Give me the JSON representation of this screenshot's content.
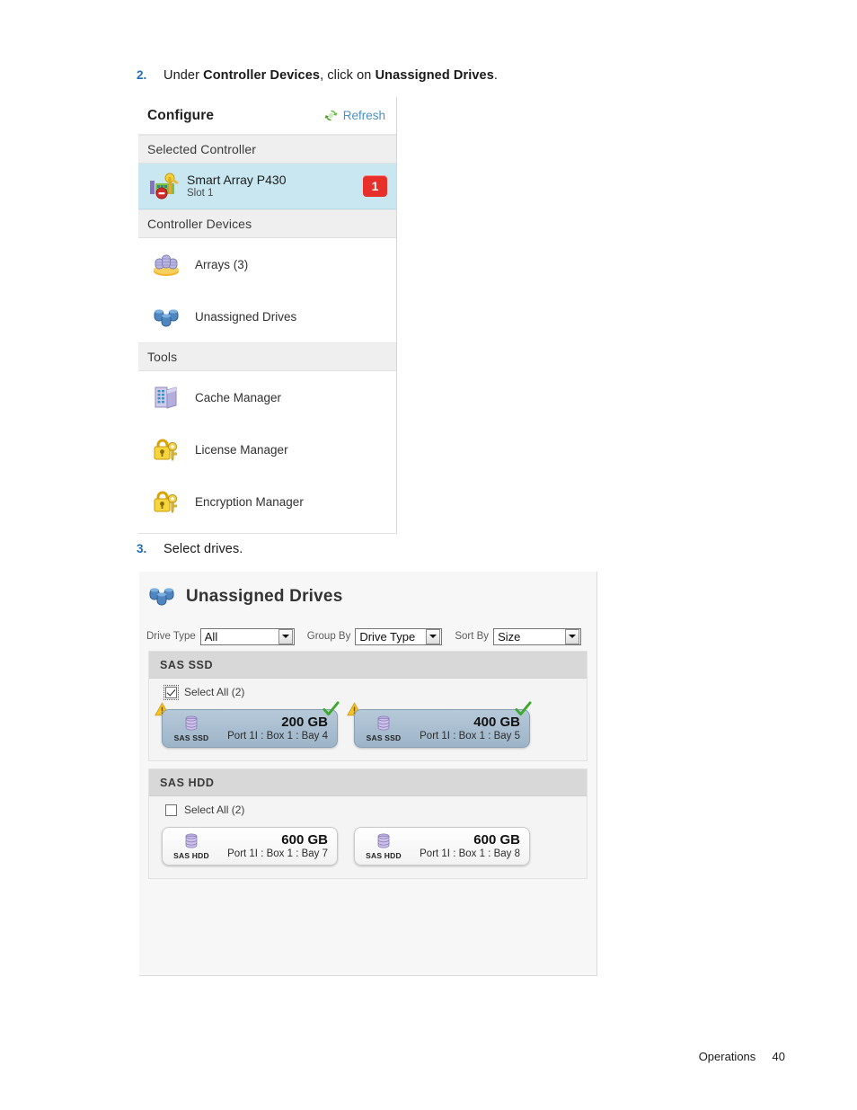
{
  "steps": [
    {
      "number": "2.",
      "pre": "Under ",
      "bold1": "Controller Devices",
      "mid": ", click on ",
      "bold2": "Unassigned Drives",
      "post": "."
    },
    {
      "number": "3.",
      "text": "Select drives."
    }
  ],
  "configure_panel": {
    "title": "Configure",
    "refresh_label": "Refresh",
    "refresh_icon": "refresh-icon",
    "sections": {
      "selected_controller": "Selected Controller",
      "controller_devices": "Controller Devices",
      "tools": "Tools"
    },
    "controller": {
      "name": "Smart Array P430",
      "slot": "Slot 1",
      "badge_count": "1",
      "badge_color": "#e8302b",
      "row_highlight_color": "#c9e7f0",
      "icon": "raid-controller-icon"
    },
    "devices": [
      {
        "label": "Arrays (3)",
        "icon": "arrays-icon"
      },
      {
        "label": "Unassigned Drives",
        "icon": "unassigned-drives-icon"
      }
    ],
    "tools": [
      {
        "label": "Cache Manager",
        "icon": "cache-manager-icon"
      },
      {
        "label": "License Manager",
        "icon": "lock-key-icon"
      },
      {
        "label": "Encryption Manager",
        "icon": "lock-key-icon"
      }
    ]
  },
  "drives_panel": {
    "title": "Unassigned Drives",
    "title_icon": "unassigned-drives-icon",
    "filters": [
      {
        "label": "Drive Type",
        "value": "All"
      },
      {
        "label": "Group By",
        "value": "Drive Type"
      },
      {
        "label": "Sort By",
        "value": "Size"
      }
    ],
    "groups": [
      {
        "name": "SAS SSD",
        "select_all_label": "Select All (2)",
        "select_all_checked": true,
        "drives": [
          {
            "size": "200 GB",
            "type": "SAS SSD",
            "location": "Port 1I : Box 1 : Bay 4",
            "selected": true,
            "warning": true,
            "check": true
          },
          {
            "size": "400 GB",
            "type": "SAS SSD",
            "location": "Port 1I : Box 1 : Bay 5",
            "selected": true,
            "warning": true,
            "check": true
          }
        ]
      },
      {
        "name": "SAS HDD",
        "select_all_label": "Select All (2)",
        "select_all_checked": false,
        "drives": [
          {
            "size": "600 GB",
            "type": "SAS HDD",
            "location": "Port 1I : Box 1 : Bay 7",
            "selected": false,
            "warning": false,
            "check": false
          },
          {
            "size": "600 GB",
            "type": "SAS HDD",
            "location": "Port 1I : Box 1 : Bay 8",
            "selected": false,
            "warning": false,
            "check": false
          }
        ]
      }
    ]
  },
  "footer": {
    "section": "Operations",
    "page": "40"
  }
}
